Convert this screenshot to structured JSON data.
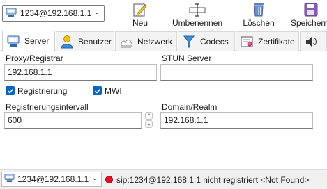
{
  "toolbar": {
    "account": "1234@192.168.1.1",
    "buttons": {
      "new_label": "Neu",
      "rename_label": "Umbenennen",
      "delete_label": "Löschen",
      "save_label": "Speichern"
    }
  },
  "tabs": [
    {
      "label": "Server",
      "icon": "server-icon",
      "active": true
    },
    {
      "label": "Benutzer",
      "icon": "user-icon",
      "active": false
    },
    {
      "label": "Netzwerk",
      "icon": "network-icon",
      "active": false
    },
    {
      "label": "Codecs",
      "icon": "codecs-icon",
      "active": false
    },
    {
      "label": "Zertifikate",
      "icon": "certificate-icon",
      "active": false
    },
    {
      "label": "",
      "icon": "speaker-icon",
      "active": false
    }
  ],
  "form": {
    "proxy_label": "Proxy/Registrar",
    "proxy_value": "192.168.1.1",
    "stun_label": "STUN Server",
    "stun_value": "",
    "registration_label": "Registrierung",
    "registration_checked": true,
    "mwi_label": "MWI",
    "mwi_checked": true,
    "interval_label": "Registrierungsintervall",
    "interval_value": "600",
    "domain_label": "Domain/Realm",
    "domain_value": "192.168.1.1"
  },
  "statusbar": {
    "account": "1234@192.168.1.1",
    "status_color": "#e81123",
    "status_text": "sip:1234@192.168.1.1 nicht registriert <Not Found>"
  },
  "colors": {
    "accent": "#0067c0",
    "error": "#e81123"
  }
}
